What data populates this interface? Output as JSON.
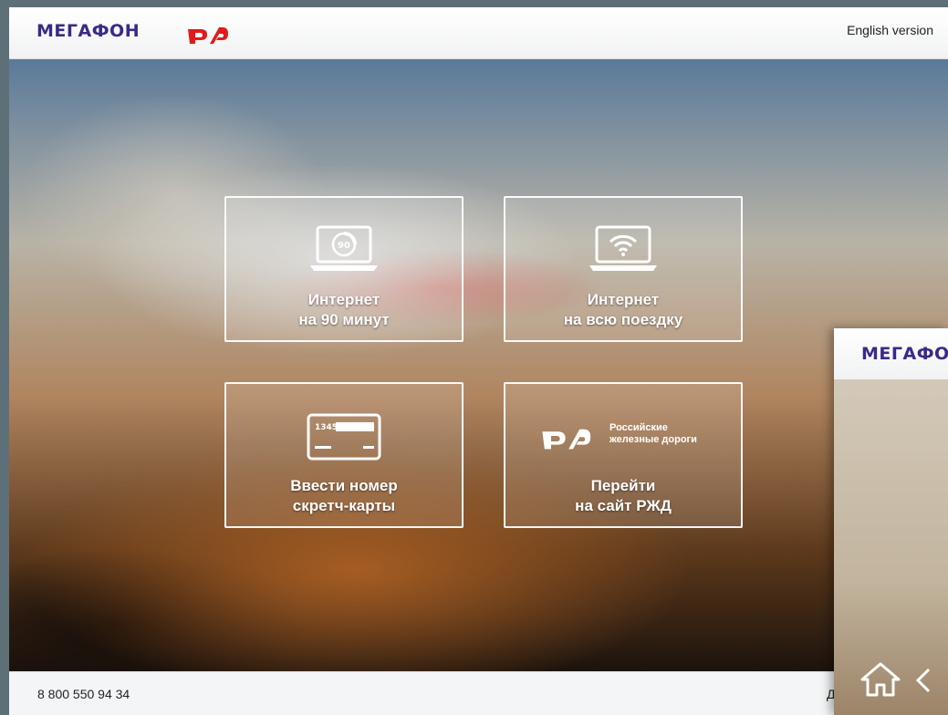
{
  "header": {
    "brand": "МЕГАФОН",
    "partner_logo_text": "РЖД",
    "language_link": "English version"
  },
  "tiles": [
    {
      "line1": "Интернет",
      "line2": "на 90 минут",
      "icon": "laptop-90-icon"
    },
    {
      "line1": "Интернет",
      "line2": "на всю поездку",
      "icon": "laptop-wifi-icon"
    },
    {
      "line1": "Ввести номер",
      "line2": "скретч-карты",
      "icon": "scratch-card-icon",
      "card_number": "1345"
    },
    {
      "line1": "Перейти",
      "line2": "на сайт РЖД",
      "icon": "rzd-logo-icon",
      "brand_line1": "Российские",
      "brand_line2": "железные дороги"
    }
  ],
  "footer": {
    "phone": "8 800 550 94 34",
    "right_text": "Д"
  },
  "overlay": {
    "brand": "МЕГАФОН",
    "icons": [
      "home-icon",
      "chevron-left-icon"
    ]
  },
  "colors": {
    "megafon_purple": "#3b2a86",
    "rzd_red": "#e21a1a"
  }
}
